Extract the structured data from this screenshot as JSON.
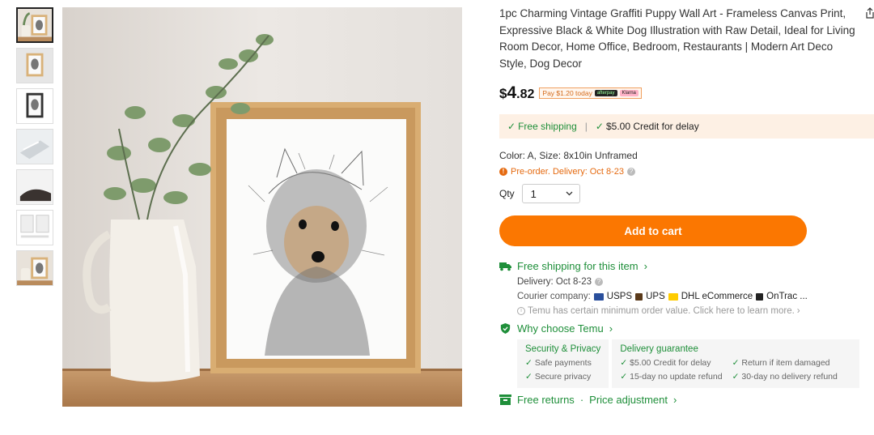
{
  "product": {
    "title": "1pc Charming Vintage Graffiti Puppy Wall Art - Frameless Canvas Print, Expressive Black & White Dog Illustration with Raw Detail, Ideal for Living Room Decor, Home Office, Bedroom, Restaurants | Modern Art Deco Style, Dog Decor",
    "price_currency": "$",
    "price_int": "4",
    "price_dec": ".82",
    "pay_badge_text": "Pay $1.20 today",
    "pay_badge_brand1": "afterpay",
    "pay_badge_brand2": "Klarna"
  },
  "shipping_bar": {
    "free_shipping": "Free shipping",
    "separator": "|",
    "credit": "$5.00 Credit for delay"
  },
  "variant": {
    "text": "Color: A, Size: 8x10in Unframed",
    "preorder": "Pre-order. Delivery: Oct 8-23"
  },
  "qty": {
    "label": "Qty",
    "value": "1"
  },
  "cart_button": "Add to cart",
  "shipping_section": {
    "title": "Free shipping for this item",
    "delivery": "Delivery: Oct 8-23",
    "courier_label": "Courier company:",
    "couriers": [
      "USPS",
      "UPS",
      "DHL eCommerce",
      "OnTrac ..."
    ],
    "min_order": "Temu has certain minimum order value. Click here to learn more."
  },
  "why_choose": {
    "title": "Why choose Temu",
    "security_title": "Security & Privacy",
    "security_items": [
      "Safe payments",
      "Secure privacy"
    ],
    "delivery_title": "Delivery guarantee",
    "delivery_col1": [
      "$5.00 Credit for delay",
      "15-day no update refund"
    ],
    "delivery_col2": [
      "Return if item damaged",
      "30-day no delivery refund"
    ]
  },
  "returns": {
    "text": "Free returns",
    "sep": "·",
    "text2": "Price adjustment"
  },
  "colors": {
    "accent_orange": "#fb7701",
    "green": "#1f8f3a",
    "ship_bar_bg": "#fdf0e4"
  },
  "icons": [
    "share-icon",
    "check-icon",
    "truck-icon",
    "shield-icon",
    "returns-icon",
    "info-icon",
    "chevron-down-icon",
    "chevron-right-icon"
  ]
}
